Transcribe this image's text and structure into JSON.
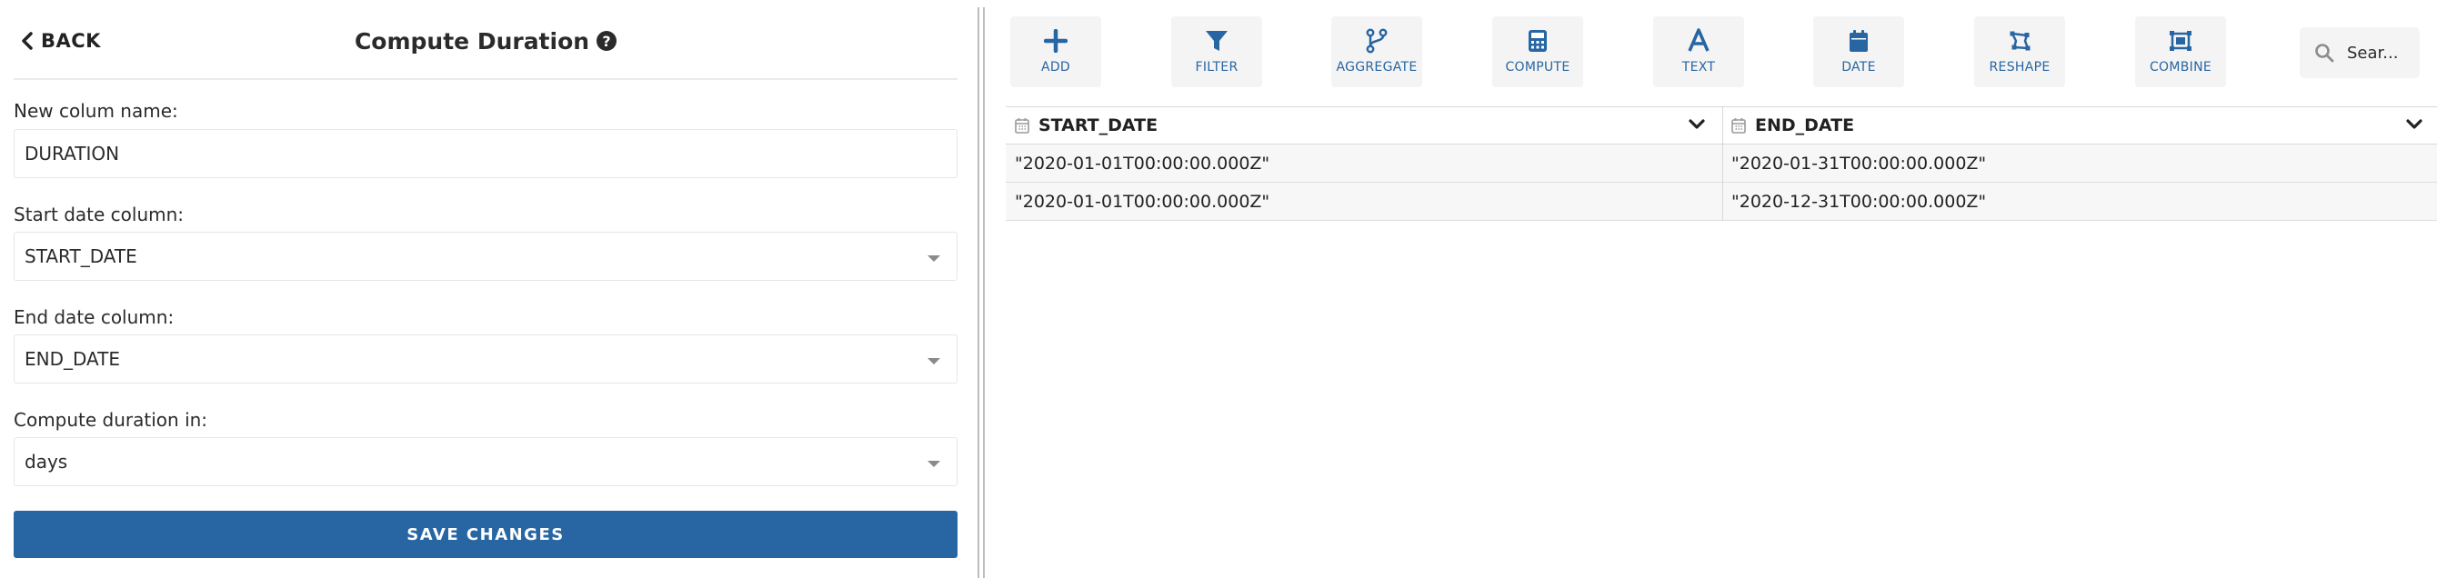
{
  "left_panel": {
    "back_label": "BACK",
    "title": "Compute Duration",
    "help_glyph": "?",
    "fields": [
      {
        "label": "New colum name:",
        "value": "DURATION"
      },
      {
        "label": "Start date column:",
        "value": "START_DATE"
      },
      {
        "label": "End date column:",
        "value": "END_DATE"
      },
      {
        "label": "Compute duration in:",
        "value": "days"
      }
    ],
    "save_label": "SAVE CHANGES"
  },
  "toolbar": {
    "accent_color": "#2865a3",
    "buttons": [
      {
        "label": "ADD",
        "icon": "plus-icon"
      },
      {
        "label": "FILTER",
        "icon": "filter-icon"
      },
      {
        "label": "AGGREGATE",
        "icon": "branch-icon"
      },
      {
        "label": "COMPUTE",
        "icon": "calculator-icon"
      },
      {
        "label": "TEXT",
        "icon": "text-icon"
      },
      {
        "label": "DATE",
        "icon": "calendar-icon"
      },
      {
        "label": "RESHAPE",
        "icon": "reshape-icon"
      },
      {
        "label": "COMBINE",
        "icon": "combine-icon"
      }
    ],
    "search_placeholder": "Sear..."
  },
  "table": {
    "columns": [
      {
        "name": "START_DATE",
        "type_icon": "calendar-icon"
      },
      {
        "name": "END_DATE",
        "type_icon": "calendar-icon"
      }
    ],
    "rows": [
      [
        "\"2020-01-01T00:00:00.000Z\"",
        "\"2020-01-31T00:00:00.000Z\""
      ],
      [
        "\"2020-01-01T00:00:00.000Z\"",
        "\"2020-12-31T00:00:00.000Z\""
      ]
    ]
  }
}
